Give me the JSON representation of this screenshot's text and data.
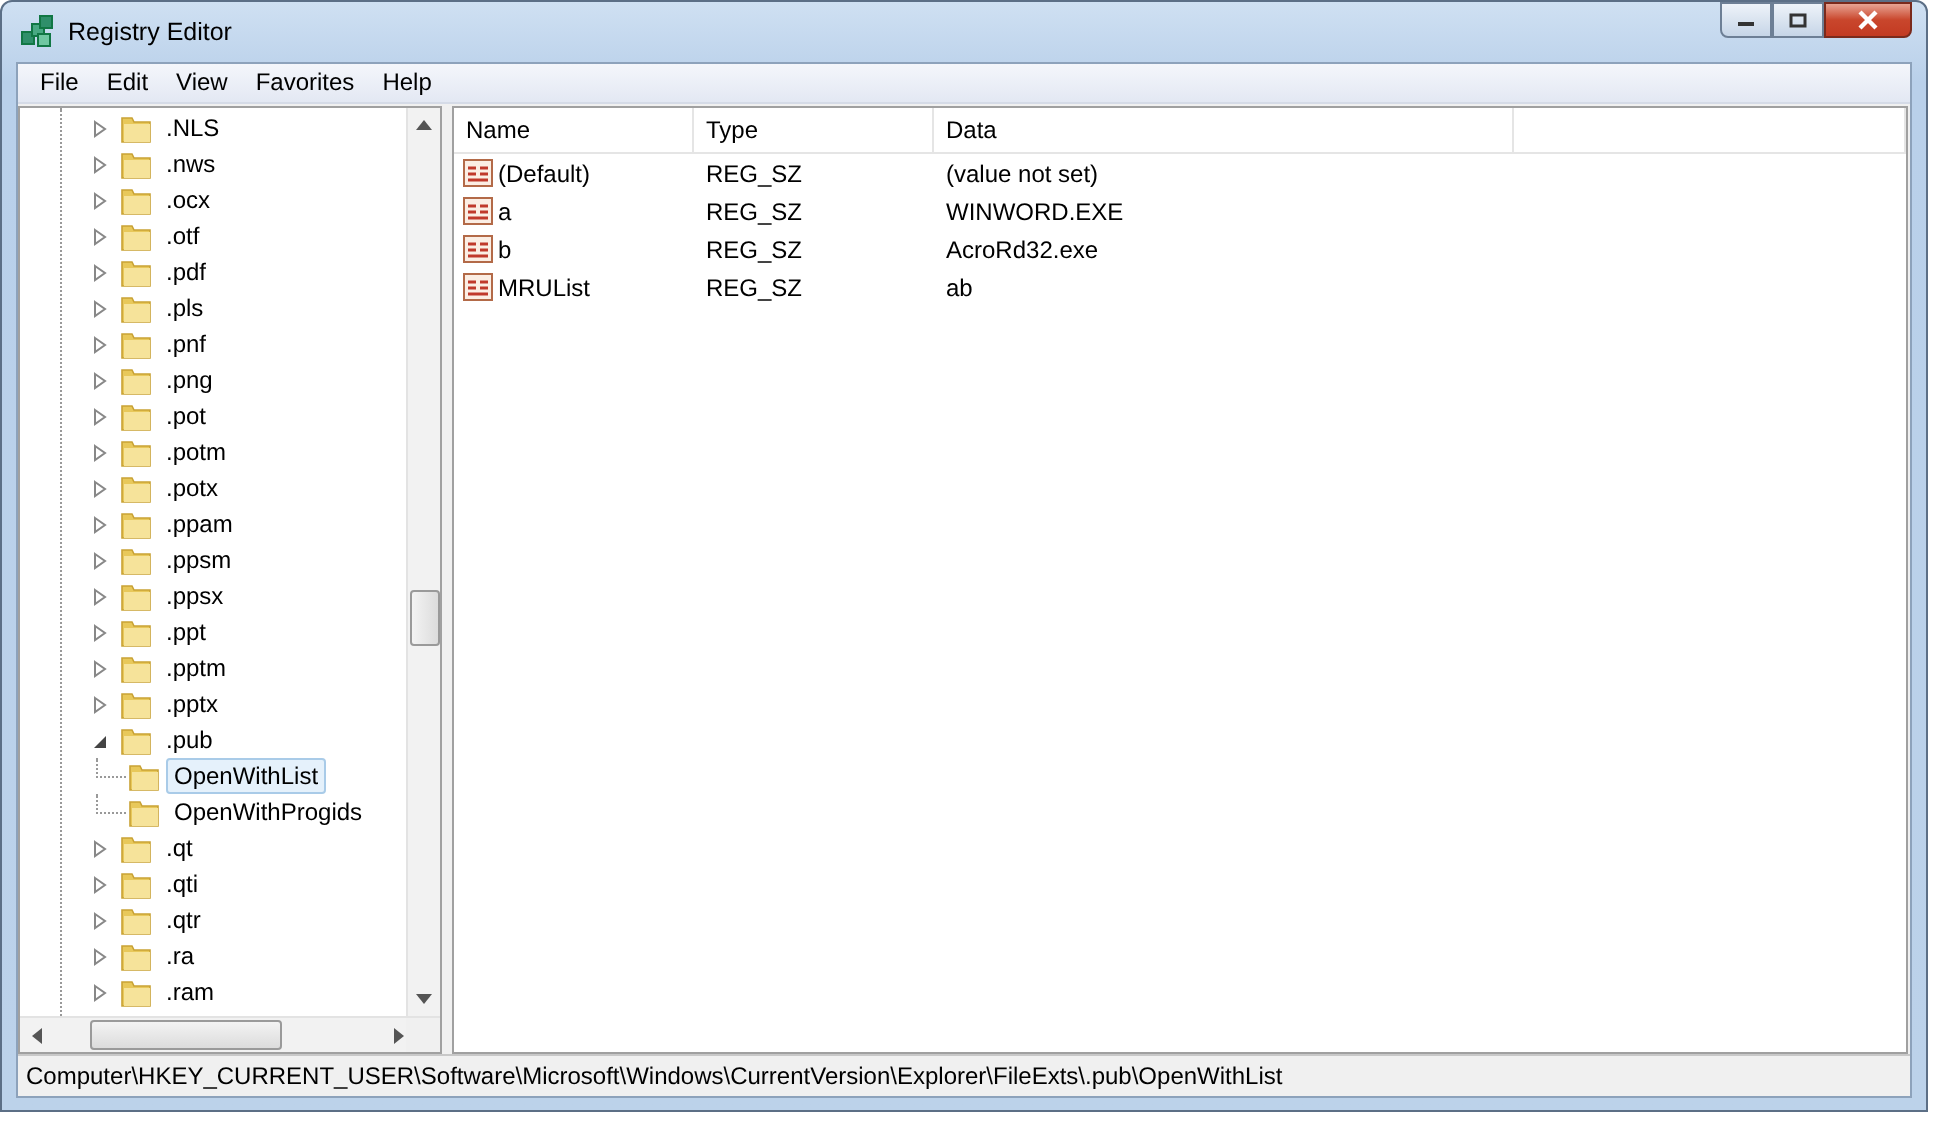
{
  "window": {
    "title": "Registry Editor"
  },
  "menu": [
    "File",
    "Edit",
    "View",
    "Favorites",
    "Help"
  ],
  "tree": [
    {
      "label": ".NLS",
      "expanded": false,
      "selected": false
    },
    {
      "label": ".nws",
      "expanded": false,
      "selected": false
    },
    {
      "label": ".ocx",
      "expanded": false,
      "selected": false
    },
    {
      "label": ".otf",
      "expanded": false,
      "selected": false
    },
    {
      "label": ".pdf",
      "expanded": false,
      "selected": false
    },
    {
      "label": ".pls",
      "expanded": false,
      "selected": false
    },
    {
      "label": ".pnf",
      "expanded": false,
      "selected": false
    },
    {
      "label": ".png",
      "expanded": false,
      "selected": false
    },
    {
      "label": ".pot",
      "expanded": false,
      "selected": false
    },
    {
      "label": ".potm",
      "expanded": false,
      "selected": false
    },
    {
      "label": ".potx",
      "expanded": false,
      "selected": false
    },
    {
      "label": ".ppam",
      "expanded": false,
      "selected": false
    },
    {
      "label": ".ppsm",
      "expanded": false,
      "selected": false
    },
    {
      "label": ".ppsx",
      "expanded": false,
      "selected": false
    },
    {
      "label": ".ppt",
      "expanded": false,
      "selected": false
    },
    {
      "label": ".pptm",
      "expanded": false,
      "selected": false
    },
    {
      "label": ".pptx",
      "expanded": false,
      "selected": false
    },
    {
      "label": ".pub",
      "expanded": true,
      "selected": false,
      "children": [
        {
          "label": "OpenWithList",
          "selected": true
        },
        {
          "label": "OpenWithProgids",
          "selected": false
        }
      ]
    },
    {
      "label": ".qt",
      "expanded": false,
      "selected": false
    },
    {
      "label": ".qti",
      "expanded": false,
      "selected": false
    },
    {
      "label": ".qtr",
      "expanded": false,
      "selected": false
    },
    {
      "label": ".ra",
      "expanded": false,
      "selected": false
    },
    {
      "label": ".ram",
      "expanded": false,
      "selected": false
    }
  ],
  "values": {
    "columns": [
      "Name",
      "Type",
      "Data"
    ],
    "rows": [
      {
        "name": "(Default)",
        "type": "REG_SZ",
        "data": "(value not set)"
      },
      {
        "name": "a",
        "type": "REG_SZ",
        "data": "WINWORD.EXE"
      },
      {
        "name": "b",
        "type": "REG_SZ",
        "data": "AcroRd32.exe"
      },
      {
        "name": "MRUList",
        "type": "REG_SZ",
        "data": "ab"
      }
    ]
  },
  "status_bar": "Computer\\HKEY_CURRENT_USER\\Software\\Microsoft\\Windows\\CurrentVersion\\Explorer\\FileExts\\.pub\\OpenWithList"
}
